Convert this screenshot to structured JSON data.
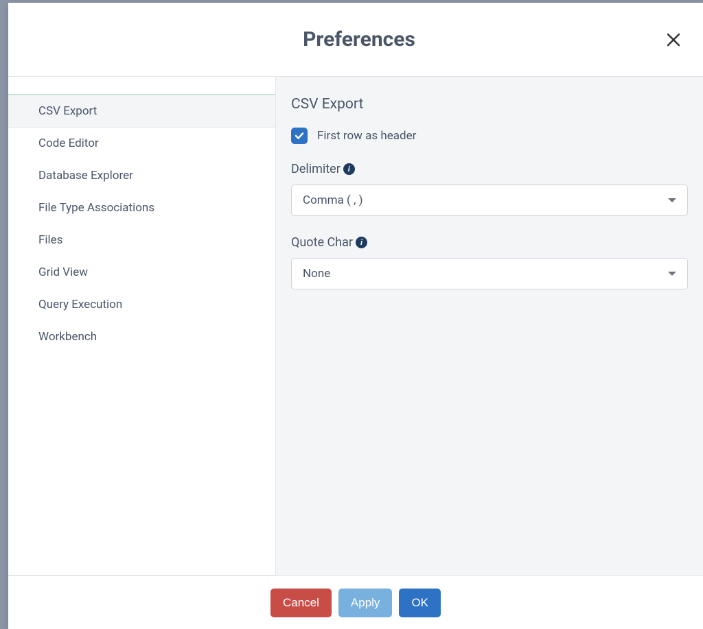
{
  "modal": {
    "title": "Preferences"
  },
  "sidebar": {
    "items": [
      {
        "label": "CSV Export",
        "active": true
      },
      {
        "label": "Code Editor",
        "active": false
      },
      {
        "label": "Database Explorer",
        "active": false
      },
      {
        "label": "File Type Associations",
        "active": false
      },
      {
        "label": "Files",
        "active": false
      },
      {
        "label": "Grid View",
        "active": false
      },
      {
        "label": "Query Execution",
        "active": false
      },
      {
        "label": "Workbench",
        "active": false
      }
    ]
  },
  "content": {
    "title": "CSV Export",
    "checkbox_label": "First row as header",
    "checkbox_checked": true,
    "delimiter_label": "Delimiter",
    "delimiter_value": "Comma ( , )",
    "quote_label": "Quote Char",
    "quote_value": "None"
  },
  "footer": {
    "cancel": "Cancel",
    "apply": "Apply",
    "ok": "OK"
  }
}
